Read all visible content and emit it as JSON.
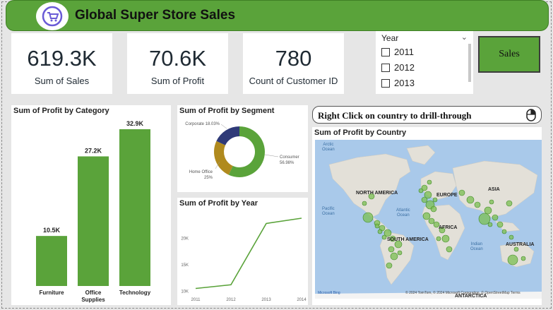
{
  "header": {
    "title": "Global Super Store Sales"
  },
  "kpis": [
    {
      "value": "619.3K",
      "label": "Sum of Sales"
    },
    {
      "value": "70.6K",
      "label": "Sum of Profit"
    },
    {
      "value": "780",
      "label": "Count of Customer ID"
    }
  ],
  "year_slicer": {
    "title": "Year",
    "options": [
      "2011",
      "2012",
      "2013"
    ]
  },
  "sales_button": {
    "label": "Sales"
  },
  "drill_through": {
    "text": "Right  Click on country to drill-through"
  },
  "colors": {
    "accent": "#5aa33a",
    "donut_dark": "#2f3a78",
    "donut_gold": "#b08a1e",
    "map_water": "#a9c9ea",
    "map_land": "#e3e0d8"
  },
  "charts": {
    "category": {
      "title": "Sum of Profit by Category",
      "chart_data": {
        "type": "bar",
        "categories": [
          "Furniture",
          "Office\nSupplies",
          "Technology"
        ],
        "values": [
          10.5,
          27.2,
          32.9
        ],
        "data_labels": [
          "10.5K",
          "27.2K",
          "32.9K"
        ]
      }
    },
    "segment": {
      "title": "Sum of Profit by Segment",
      "chart_data": {
        "type": "pie",
        "categories": [
          "Consumer",
          "Home Office",
          "Corporate"
        ],
        "values": [
          56.98,
          25,
          18.03
        ],
        "data_labels": [
          "Consumer\n56.98%",
          "Home Office\n25%",
          "Corporate 18.03%"
        ]
      }
    },
    "year": {
      "title": "Sum of Profit by Year",
      "chart_data": {
        "type": "line",
        "x": [
          "2011",
          "2012",
          "2013",
          "2014"
        ],
        "values": [
          10.5,
          11.2,
          22.8,
          23.8
        ],
        "yticks": [
          "10K",
          "15K",
          "20K"
        ],
        "ytick_values": [
          10,
          15,
          20
        ],
        "ylim": [
          9.5,
          25
        ]
      }
    },
    "country": {
      "title": "Sum of Profit by Country",
      "ocean_labels": [
        "Arctic\nOcean",
        "Pacific\nOcean",
        "Atlantic\nOcean",
        "Indian\nOcean"
      ],
      "continent_labels": [
        "NORTH AMERICA",
        "EUROPE",
        "ASIA",
        "AFRICA",
        "SOUTH AMERICA",
        "AUSTRALIA",
        "ANTARCTICA"
      ],
      "credit": "© 2024 TomTom, © 2024 Microsoft Corporation, © OpenStreetMap  Terms",
      "bing": "Microsoft Bing"
    }
  }
}
